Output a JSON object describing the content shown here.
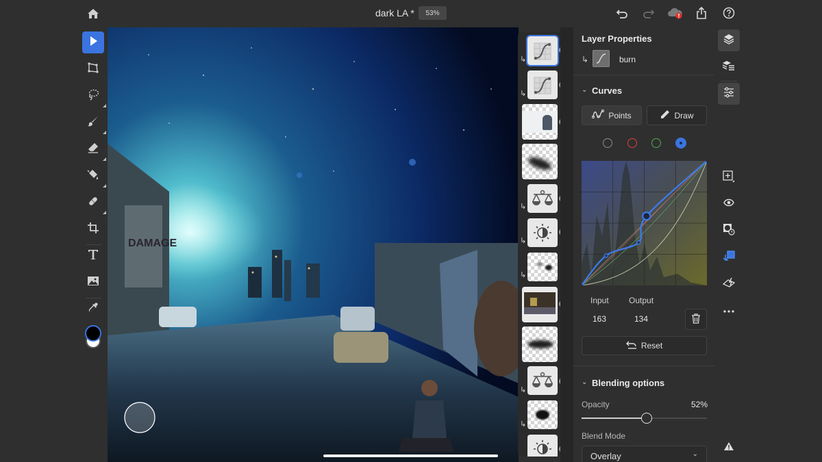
{
  "app": {
    "document_title": "dark LA *",
    "zoom_level": "53%"
  },
  "topbar": {
    "icons": [
      "home-icon",
      "undo-icon",
      "redo-icon",
      "cloud-sync-error-icon",
      "share-icon",
      "help-icon"
    ]
  },
  "toolbar": {
    "tools": [
      {
        "name": "move-tool",
        "icon": "arrow-pointer-icon",
        "active": true
      },
      {
        "name": "transform-tool",
        "icon": "transform-icon"
      },
      {
        "name": "lasso-tool",
        "icon": "lasso-icon",
        "has_submenu": true
      },
      {
        "name": "brush-tool",
        "icon": "brush-icon",
        "has_submenu": true
      },
      {
        "name": "eraser-tool",
        "icon": "eraser-icon",
        "has_submenu": true
      },
      {
        "name": "fill-tool",
        "icon": "paint-bucket-icon",
        "has_submenu": true
      },
      {
        "name": "healing-tool",
        "icon": "bandage-icon",
        "has_submenu": true
      },
      {
        "name": "crop-tool",
        "icon": "crop-icon"
      },
      {
        "name": "type-tool",
        "icon": "type-icon"
      },
      {
        "name": "place-image-tool",
        "icon": "image-icon"
      },
      {
        "name": "eyedropper-tool",
        "icon": "eyedropper-icon"
      }
    ],
    "foreground_color": "#000000",
    "background_color": "#ffffff"
  },
  "layers": [
    {
      "type": "curves",
      "icon": "curves-icon",
      "selected": true,
      "clipped": true
    },
    {
      "type": "curves",
      "icon": "curves-icon",
      "clipped": true
    },
    {
      "type": "pixel",
      "thumb": "boy-photo"
    },
    {
      "type": "mask",
      "thumb": "dark-brush-mask"
    },
    {
      "type": "color-balance",
      "icon": "balance-scale-icon",
      "clipped": true
    },
    {
      "type": "brightness-contrast",
      "icon": "brightness-icon",
      "clipped": true
    },
    {
      "type": "mask",
      "thumb": "small-blobs-mask",
      "clipped": true
    },
    {
      "type": "pixel",
      "thumb": "street-photo"
    },
    {
      "type": "mask",
      "thumb": "dark-stroke-mask"
    },
    {
      "type": "color-balance",
      "icon": "balance-scale-icon",
      "clipped": true
    },
    {
      "type": "mask",
      "thumb": "blob-mask",
      "clipped": true
    },
    {
      "type": "brightness-contrast",
      "icon": "brightness-icon"
    }
  ],
  "properties": {
    "title": "Layer Properties",
    "layer_name": "burn",
    "curves": {
      "section_label": "Curves",
      "mode_points": "Points",
      "mode_draw": "Draw",
      "channels": [
        {
          "name": "rgb",
          "color": "#8a8a8a"
        },
        {
          "name": "red",
          "color": "#e0413b"
        },
        {
          "name": "green",
          "color": "#4caf50"
        },
        {
          "name": "blue",
          "color": "#3b74e0",
          "selected": true
        }
      ],
      "blue_curve_points": [
        [
          0,
          0
        ],
        [
          50,
          61
        ],
        [
          116,
          88
        ],
        [
          132,
          142
        ],
        [
          255,
          255
        ]
      ],
      "input_label": "Input",
      "output_label": "Output",
      "input_value": "163",
      "output_value": "134",
      "reset_label": "Reset"
    },
    "blending": {
      "section_label": "Blending options",
      "opacity_label": "Opacity",
      "opacity_value": "52%",
      "opacity": 0.52,
      "blend_mode_label": "Blend Mode",
      "blend_mode_value": "Overlay"
    }
  },
  "rail": {
    "icons": [
      "layers-icon",
      "layer-list-icon",
      "adjustments-icon",
      "add-layer-icon",
      "visibility-icon",
      "mask-icon",
      "clip-icon",
      "quick-action-icon",
      "more-icon",
      "warning-icon"
    ]
  },
  "colors": {
    "accent": "#3b74e0",
    "panel": "#2f2f2f"
  }
}
